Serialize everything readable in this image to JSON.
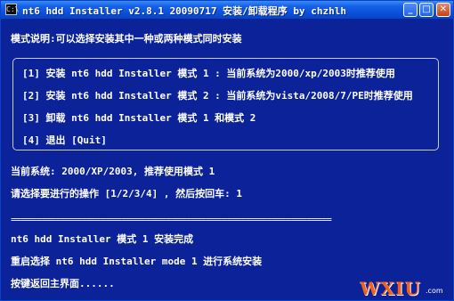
{
  "window": {
    "title": "nt6 hdd Installer v2.8.1 20090717 安装/卸载程序 by chzhlh",
    "sys_icon": "C:\\",
    "buttons": {
      "minimize": "_",
      "maximize": "□",
      "close": "✕"
    }
  },
  "console": {
    "mode_desc": "模式说明:可以选择安装其中一种或两种模式同时安装",
    "menu_items": [
      "[1] 安装 nt6 hdd Installer 模式 1 : 当前系统为2000/xp/2003时推荐使用",
      "[2] 安装 nt6 hdd Installer 模式 2 : 当前系统为vista/2008/7/PE时推荐使用",
      "[3] 卸载 nt6 hdd Installer 模式 1 和模式 2",
      "[4] 退出 [Quit]"
    ],
    "current_system": "当前系统: 2000/XP/2003, 推荐使用模式 1",
    "prompt": "请选择要进行的操作 [1/2/3/4] , 然后按回车: 1",
    "divider": "================================================================",
    "result": "nt6 hdd Installer 模式 1 安装完成",
    "restart_msg": "重启选择 nt6 hdd Installer mode 1 进行系统安装",
    "back_msg": "按键返回主界面......"
  },
  "watermark": {
    "text": "WXIU",
    "sub": ".com"
  },
  "colors": {
    "console_bg": "#0b2298",
    "text": "#ffffff",
    "titlebar": "#0a4fd7",
    "watermark": "#f2611a"
  },
  "icons": [
    "console-icon",
    "minimize-icon",
    "maximize-icon",
    "close-icon"
  ]
}
